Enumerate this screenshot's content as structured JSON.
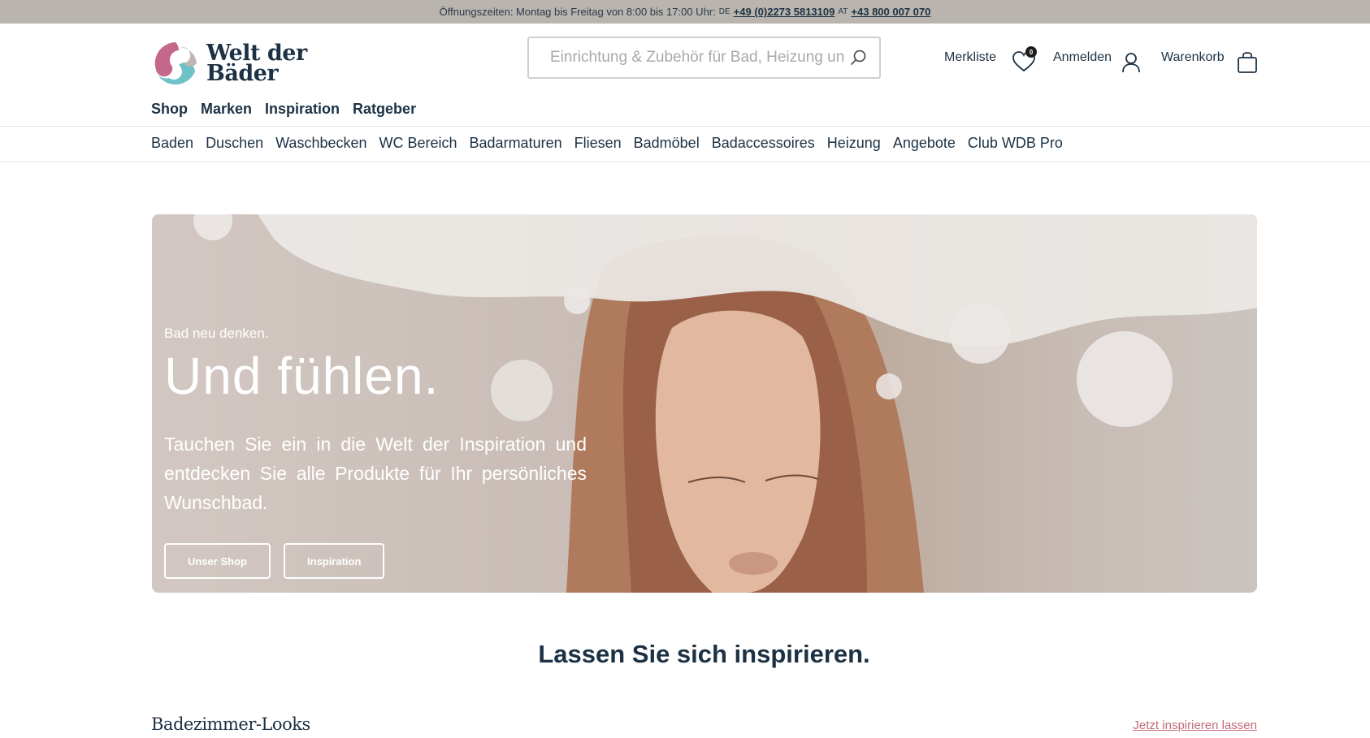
{
  "topbar": {
    "hours": "Öffnungszeiten: Montag bis Freitag von 8:00 bis 17:00 Uhr:",
    "country_de": "DE",
    "phone_de": "+49 (0)2273 5813109",
    "country_at": "AT",
    "phone_at": "+43 800 007 070"
  },
  "logo": {
    "line1": "Welt der",
    "line2": "Bäder",
    "colors": [
      "#c4678a",
      "#6fc1c8"
    ]
  },
  "search": {
    "placeholder": "Einrichtung & Zubehör für Bad, Heizung un",
    "icon": "search-icon"
  },
  "user": {
    "wishlist_label": "Merkliste",
    "wishlist_count": "0",
    "login_label": "Anmelden",
    "cart_label": "Warenkorb"
  },
  "mainnav": [
    "Shop",
    "Marken",
    "Inspiration",
    "Ratgeber"
  ],
  "categories": [
    "Baden",
    "Duschen",
    "Waschbecken",
    "WC Bereich",
    "Badarmaturen",
    "Fliesen",
    "Badmöbel",
    "Badaccessoires",
    "Heizung",
    "Angebote",
    "Club WDB Pro"
  ],
  "hero": {
    "kicker": "Bad neu denken.",
    "title": "Und fühlen.",
    "description": "Tauchen Sie ein in die Welt der Inspiration und entdecken Sie alle Produkte für Ihr persönliches Wunschbad.",
    "btn_shop": "Unser Shop",
    "btn_inspiration": "Inspiration"
  },
  "section": {
    "title": "Lassen Sie sich inspirieren."
  },
  "looks": {
    "title": "Badezimmer-Looks",
    "link": "Jetzt inspirieren lassen"
  },
  "colors": {
    "primary": "#1c3144",
    "accent_pink": "#c06a7a",
    "topbar_bg": "#b9b5ae"
  }
}
